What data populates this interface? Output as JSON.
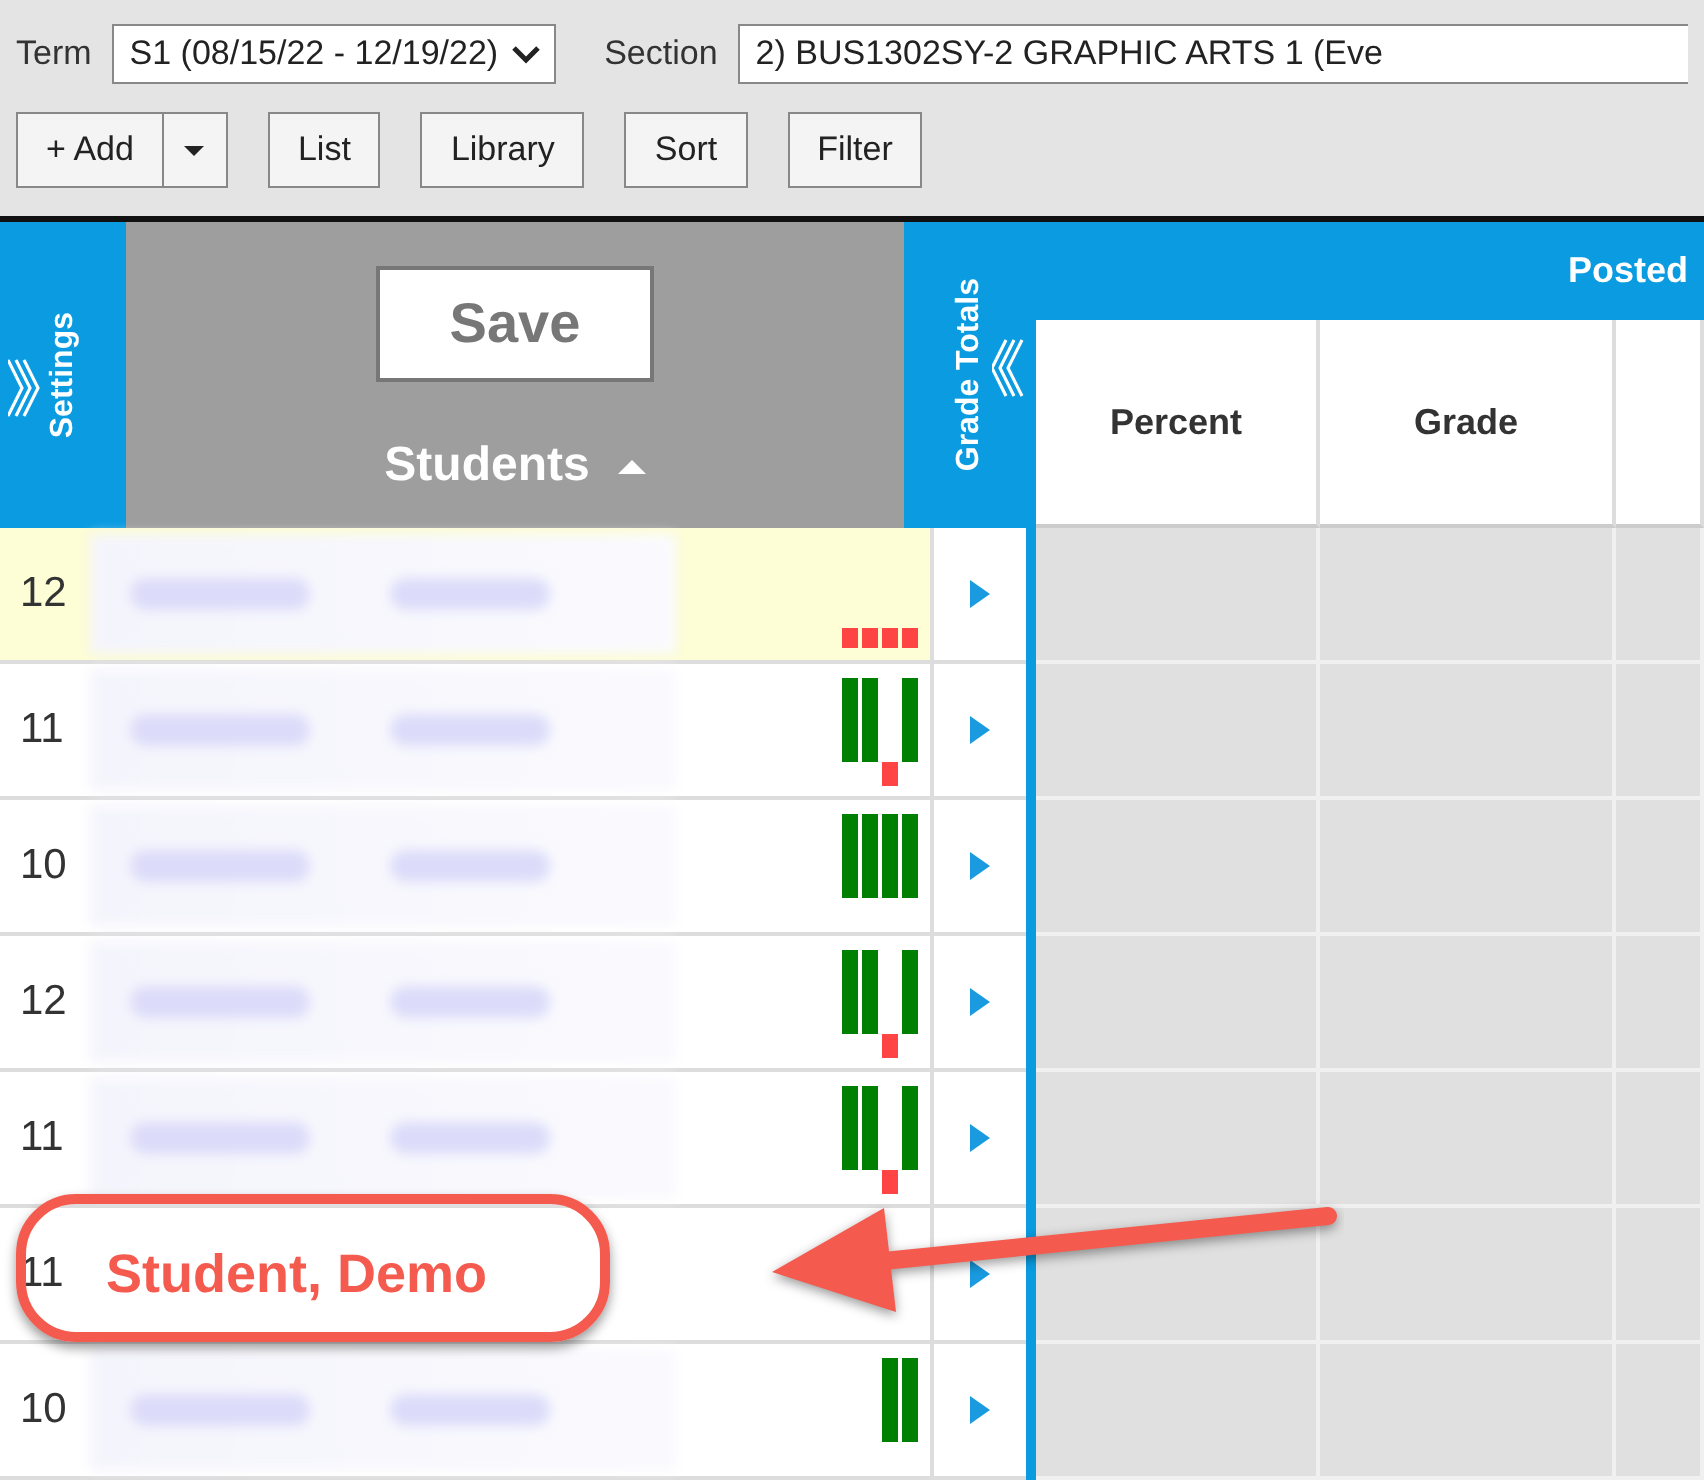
{
  "toolbar": {
    "term_label": "Term",
    "term_value": "S1 (08/15/22 - 12/19/22)",
    "section_label": "Section",
    "section_value": "2) BUS1302SY-2 GRAPHIC ARTS 1 (Eve",
    "buttons": [
      {
        "label": "+ Add",
        "kind": "split"
      },
      {
        "label": "List",
        "kind": "plain"
      },
      {
        "label": "Library",
        "kind": "plain"
      },
      {
        "label": "Sort",
        "kind": "plain"
      },
      {
        "label": "Filter",
        "kind": "plain"
      }
    ]
  },
  "settings_tab": "Settings",
  "save_button": "Save",
  "students_header": "Students",
  "grade_totals_tab": "Grade Totals",
  "posted_header": "Posted",
  "columns": [
    "Percent",
    "Grade"
  ],
  "rows": [
    {
      "grade_level": "12",
      "kind": "blurred",
      "highlighted": true,
      "marks": [
        {
          "kind": "square"
        },
        {
          "kind": "square"
        },
        {
          "kind": "square"
        },
        {
          "kind": "square"
        }
      ]
    },
    {
      "grade_level": "11",
      "kind": "blurred",
      "highlighted": false,
      "marks": [
        {
          "kind": "bar"
        },
        {
          "kind": "bar"
        },
        {
          "kind": "flag"
        },
        {
          "kind": "bar"
        }
      ]
    },
    {
      "grade_level": "10",
      "kind": "blurred",
      "highlighted": false,
      "marks": [
        {
          "kind": "bar"
        },
        {
          "kind": "bar"
        },
        {
          "kind": "bar"
        },
        {
          "kind": "bar"
        }
      ]
    },
    {
      "grade_level": "12",
      "kind": "blurred",
      "highlighted": false,
      "marks": [
        {
          "kind": "bar"
        },
        {
          "kind": "bar"
        },
        {
          "kind": "flag"
        },
        {
          "kind": "bar"
        }
      ]
    },
    {
      "grade_level": "11",
      "kind": "blurred",
      "highlighted": false,
      "marks": [
        {
          "kind": "bar"
        },
        {
          "kind": "bar"
        },
        {
          "kind": "flag"
        },
        {
          "kind": "bar"
        }
      ]
    },
    {
      "grade_level": "11",
      "kind": "named",
      "name": "Student, Demo",
      "highlighted": false,
      "annotated": true
    },
    {
      "grade_level": "10",
      "kind": "blurred",
      "highlighted": false,
      "marks": [
        {
          "kind": "blank"
        },
        {
          "kind": "blank"
        },
        {
          "kind": "bar"
        },
        {
          "kind": "bar"
        }
      ]
    }
  ]
}
